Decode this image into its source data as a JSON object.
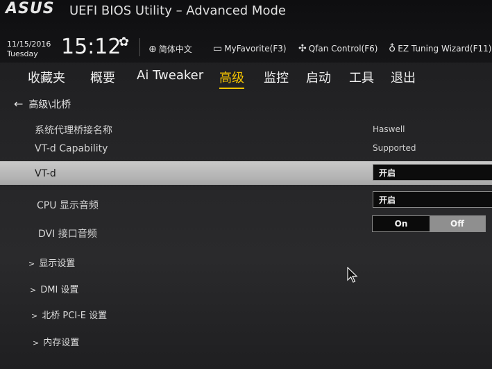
{
  "header": {
    "logo": "ASUS",
    "title": "UEFI BIOS Utility – Advanced Mode",
    "date": "11/15/2016",
    "day": "Tuesday",
    "time": "15:12",
    "buttons": [
      {
        "label": "简体中文",
        "icon": "globe-icon"
      },
      {
        "label": "MyFavorite(F3)",
        "icon": "favorite-icon"
      },
      {
        "label": "Qfan Control(F6)",
        "icon": "fan-icon"
      },
      {
        "label": "EZ Tuning Wizard(F11)",
        "icon": "bulb-icon"
      }
    ]
  },
  "tabs": [
    "收藏夹",
    "概要",
    "Ai Tweaker",
    "高级",
    "监控",
    "启动",
    "工具",
    "退出"
  ],
  "active_tab": "高级",
  "breadcrumb": "高级\\北桥",
  "info_rows": [
    {
      "label": "系统代理桥接名称",
      "value": "Haswell"
    },
    {
      "label": "VT-d Capability",
      "value": "Supported"
    }
  ],
  "settings": [
    {
      "label": "VT-d",
      "value": "开启"
    },
    {
      "label": "CPU 显示音频",
      "value": "开启"
    },
    {
      "label": "DVI 接口音频",
      "on": "On",
      "off": "Off"
    }
  ],
  "submenus": [
    "显示设置",
    "DMI 设置",
    "北桥 PCI-E 设置",
    "内存设置"
  ],
  "colors": {
    "accent": "#f5c400",
    "highlight": "#bdbdbd"
  }
}
